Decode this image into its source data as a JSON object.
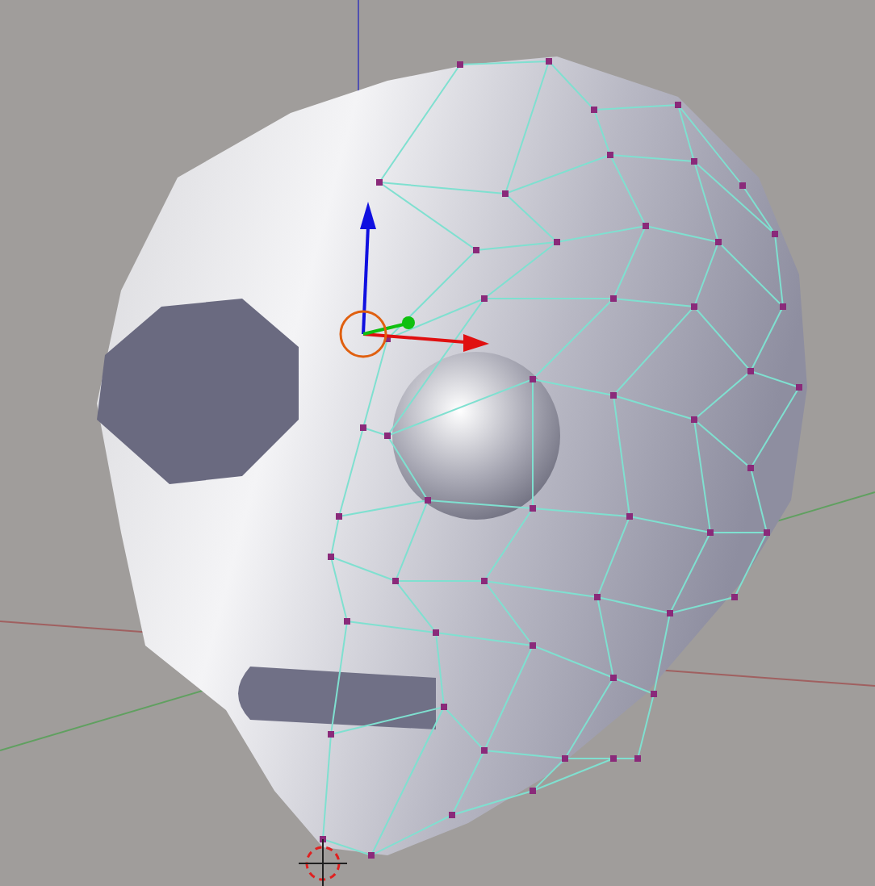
{
  "viewport": {
    "kind": "edit-mesh"
  }
}
